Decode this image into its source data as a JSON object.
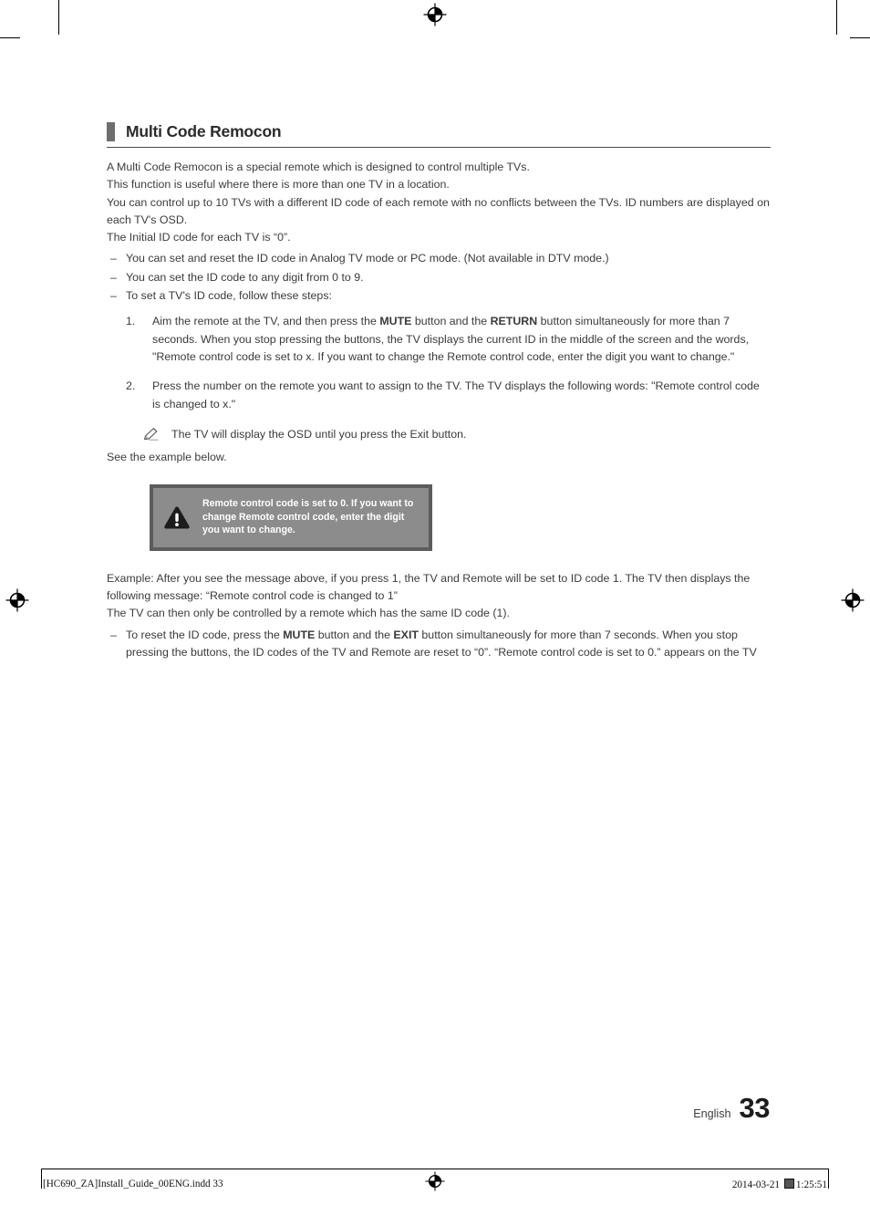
{
  "heading": {
    "title": "Multi Code Remocon",
    "accent_color": "#6e6e6e"
  },
  "intro_paragraphs": [
    "A Multi Code Remocon is a special remote which is designed to control multiple TVs.",
    "This function is useful where there is more than one TV in a location.",
    "You can control up to 10 TVs with a different ID code of each remote with no conflicts between the TVs. ID numbers are displayed on each TV's OSD.",
    "The Initial ID code for each TV is “0”."
  ],
  "dash_items": [
    "You can set and reset the ID code in Analog TV mode or PC mode. (Not available in DTV mode.)",
    "You can set the ID code to any digit from 0 to 9.",
    "To set a TV's ID code, follow these steps:"
  ],
  "dash_marker": "–",
  "numbered_steps": [
    {
      "marker": "1.",
      "text_before_first_bold": "Aim the remote at the TV, and then press the ",
      "bold_1": "MUTE",
      "text_middle": " button and the ",
      "bold_2": "RETURN",
      "text_after": " button simultaneously for more than 7 seconds. When you stop pressing the buttons, the TV displays the current ID in the middle of the screen and the words, \"Remote control code is set to x. If you want to change the Remote control code, enter the digit you want to change.\""
    },
    {
      "marker": "2.",
      "text": "Press the number on the remote you want to assign to the TV. The TV displays the following words: \"Remote control code is changed to x.\""
    }
  ],
  "note": {
    "icon": "pencil-note-icon",
    "text": "The TV will display the OSD until you press the Exit button."
  },
  "see_example": "See the example below.",
  "osd_message": {
    "icon": "warning-triangle-icon",
    "text": "Remote control code is set to 0. If you want to change Remote control code, enter the digit you want to change.",
    "fill_color": "#8c8c8c",
    "border_color": "#5c5c5c",
    "text_color": "#ffffff"
  },
  "example_paragraphs": [
    "Example: After you see the message above, if you press 1, the TV and Remote will be set to ID code 1. The TV then displays the following message: “Remote control code is changed to 1”",
    "The TV can then only be controlled by a remote which has the same ID code (1)."
  ],
  "reset_item": {
    "marker": "–",
    "text_before_first_bold": "To reset the ID code, press the ",
    "bold_1": "MUTE",
    "text_middle": " button and the ",
    "bold_2": "EXIT",
    "text_after": " button simultaneously for more than 7 seconds. When you stop pressing the buttons, the ID codes of the TV and Remote are reset to “0”. “Remote control code is set to 0.” appears on the TV"
  },
  "footer": {
    "language": "English",
    "page_number": "33"
  },
  "print_slug": {
    "filename": "[HC690_ZA]Install_Guide_00ENG.indd   33",
    "date": "2014-03-21",
    "time": "1:25:51",
    "registration_mark": "registration-target-icon"
  }
}
